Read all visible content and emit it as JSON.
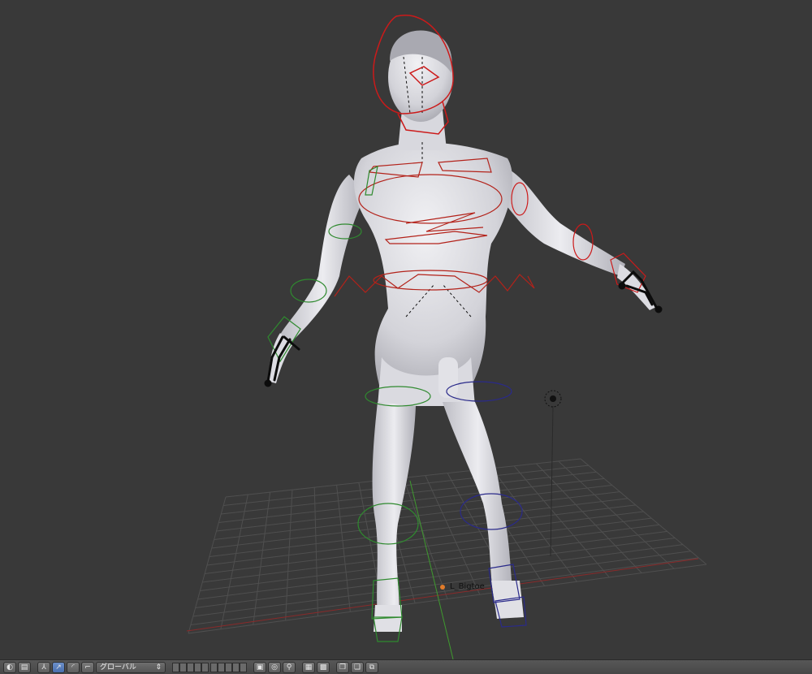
{
  "viewport": {
    "bone_label": "L_Bigtoe",
    "colors": {
      "background": "#393939",
      "grid": "#4d4d4d",
      "x_axis": "#8a2a2a",
      "y_axis": "#3a8a2a",
      "mesh": "#cfcfd6",
      "control_red": "#cc1a1a",
      "control_green": "#2f8a2f",
      "control_blue": "#2a2a8a"
    }
  },
  "toolbar": {
    "orientation_select": "グローバル",
    "buttons": [
      {
        "name": "view-button",
        "icon": "view-icon"
      },
      {
        "name": "pivot-button",
        "icon": "pivot-icon"
      },
      {
        "name": "manipulator-toggle",
        "icon": "manipulator-icon"
      },
      {
        "name": "translate-button",
        "icon": "translate-arrow-icon"
      },
      {
        "name": "rotate-button",
        "icon": "rotate-icon"
      },
      {
        "name": "scale-button",
        "icon": "scale-icon"
      }
    ]
  }
}
